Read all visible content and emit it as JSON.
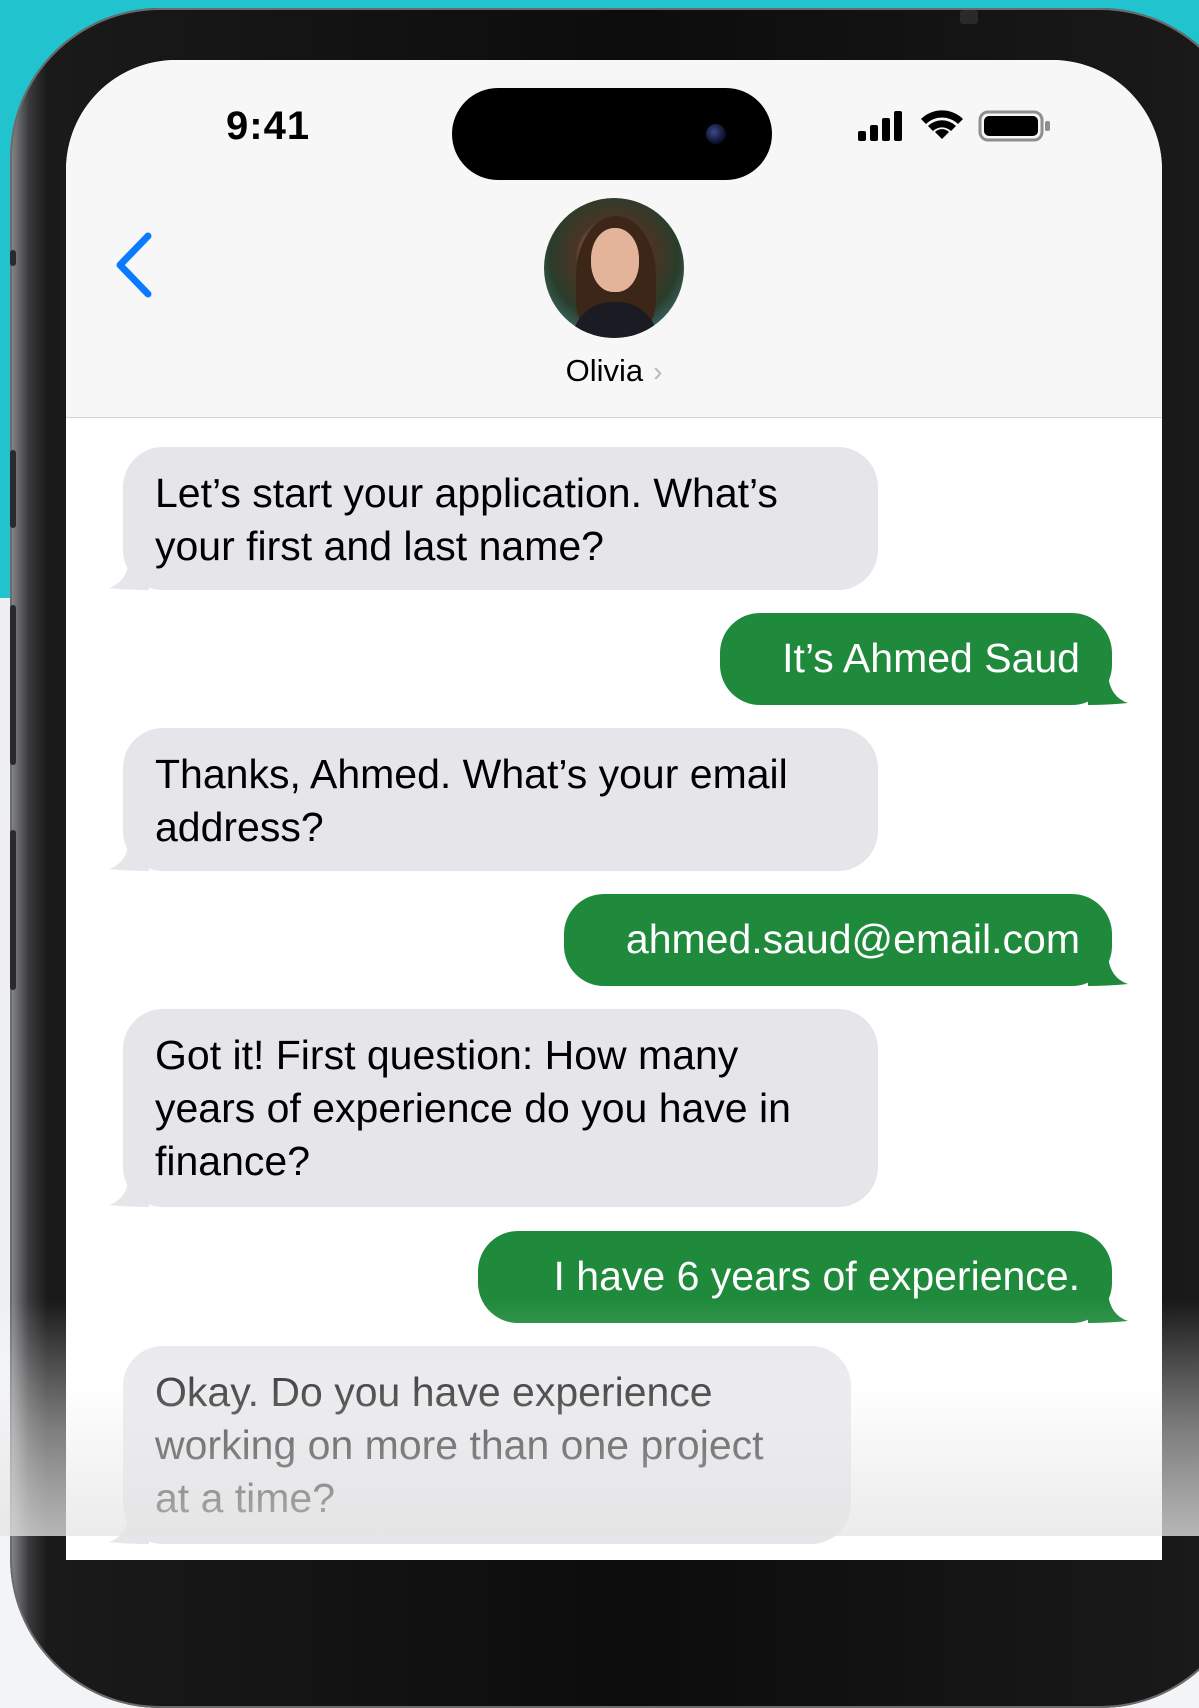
{
  "status_bar": {
    "time": "9:41",
    "icons": [
      "cellular-signal-icon",
      "wifi-icon",
      "battery-icon"
    ]
  },
  "conversation": {
    "contact_name": "Olivia",
    "avatar": "contact-photo"
  },
  "messages": [
    {
      "direction": "incoming",
      "text": "Let’s start your application. What’s\nyour first and last name?"
    },
    {
      "direction": "outgoing",
      "text": "It’s Ahmed Saud"
    },
    {
      "direction": "incoming",
      "text": "Thanks, Ahmed. What’s your email\naddress?"
    },
    {
      "direction": "outgoing",
      "text": "ahmed.saud@email.com"
    },
    {
      "direction": "incoming",
      "text": "Got it! First question: How many\nyears of experience do you have in\nfinance?"
    },
    {
      "direction": "outgoing",
      "text": "I have 6 years of experience."
    },
    {
      "direction": "incoming",
      "text": "Okay. Do you have experience\nworking on more than one project\nat a time?"
    }
  ],
  "colors": {
    "background_accent": "#21c3cf",
    "outgoing_bubble": "#208a3c",
    "incoming_bubble": "#e5e5ea",
    "link_blue": "#0a7aff"
  }
}
